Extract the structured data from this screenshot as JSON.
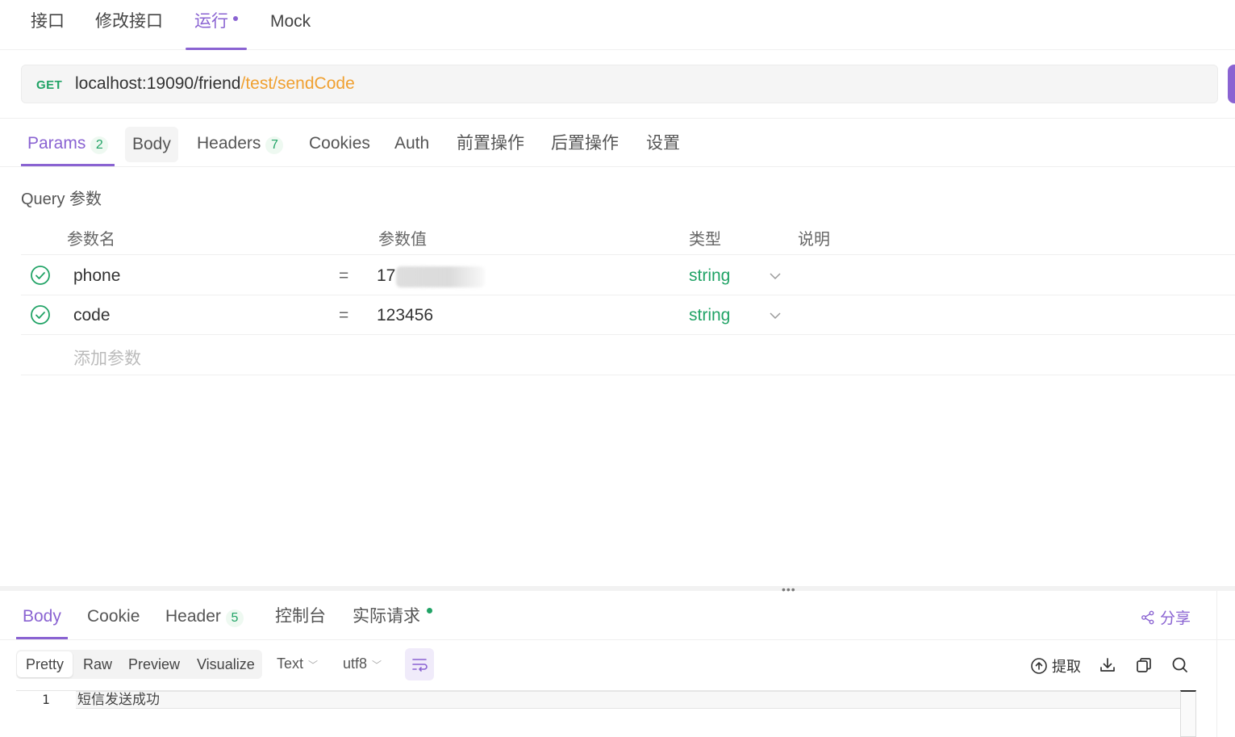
{
  "top_tabs": {
    "items": [
      {
        "label": "接口"
      },
      {
        "label": "修改接口"
      },
      {
        "label": "运行"
      },
      {
        "label": "Mock"
      }
    ],
    "active_index": 2
  },
  "url_bar": {
    "method": "GET",
    "base": "localhost:19090/friend",
    "path": "/test/sendCode"
  },
  "request_tabs": {
    "params": {
      "label": "Params",
      "count": "2"
    },
    "body": {
      "label": "Body"
    },
    "headers": {
      "label": "Headers",
      "count": "7"
    },
    "cookies": {
      "label": "Cookies"
    },
    "auth": {
      "label": "Auth"
    },
    "pre": {
      "label": "前置操作"
    },
    "post": {
      "label": "后置操作"
    },
    "settings": {
      "label": "设置"
    }
  },
  "query": {
    "title": "Query 参数",
    "columns": {
      "name": "参数名",
      "value": "参数值",
      "type": "类型",
      "desc": "说明"
    },
    "rows": [
      {
        "name": "phone",
        "eq": "=",
        "value": "17",
        "type": "string"
      },
      {
        "name": "code",
        "eq": "=",
        "value": "123456",
        "type": "string"
      }
    ],
    "add_placeholder": "添加参数"
  },
  "response_tabs": {
    "body": {
      "label": "Body"
    },
    "cookie": {
      "label": "Cookie"
    },
    "header": {
      "label": "Header",
      "count": "5"
    },
    "console": {
      "label": "控制台"
    },
    "actual": {
      "label": "实际请求"
    },
    "share": {
      "label": "分享"
    }
  },
  "response_toolbar": {
    "view_modes": [
      "Pretty",
      "Raw",
      "Preview",
      "Visualize"
    ],
    "active_view": "Pretty",
    "format": "Text",
    "encoding": "utf8",
    "extract_label": "提取"
  },
  "response_body": {
    "lines": [
      {
        "num": "1",
        "text": "短信发送成功"
      }
    ]
  },
  "colors": {
    "accent": "#8a63d2",
    "success": "#21a366",
    "path": "#f0a030"
  }
}
